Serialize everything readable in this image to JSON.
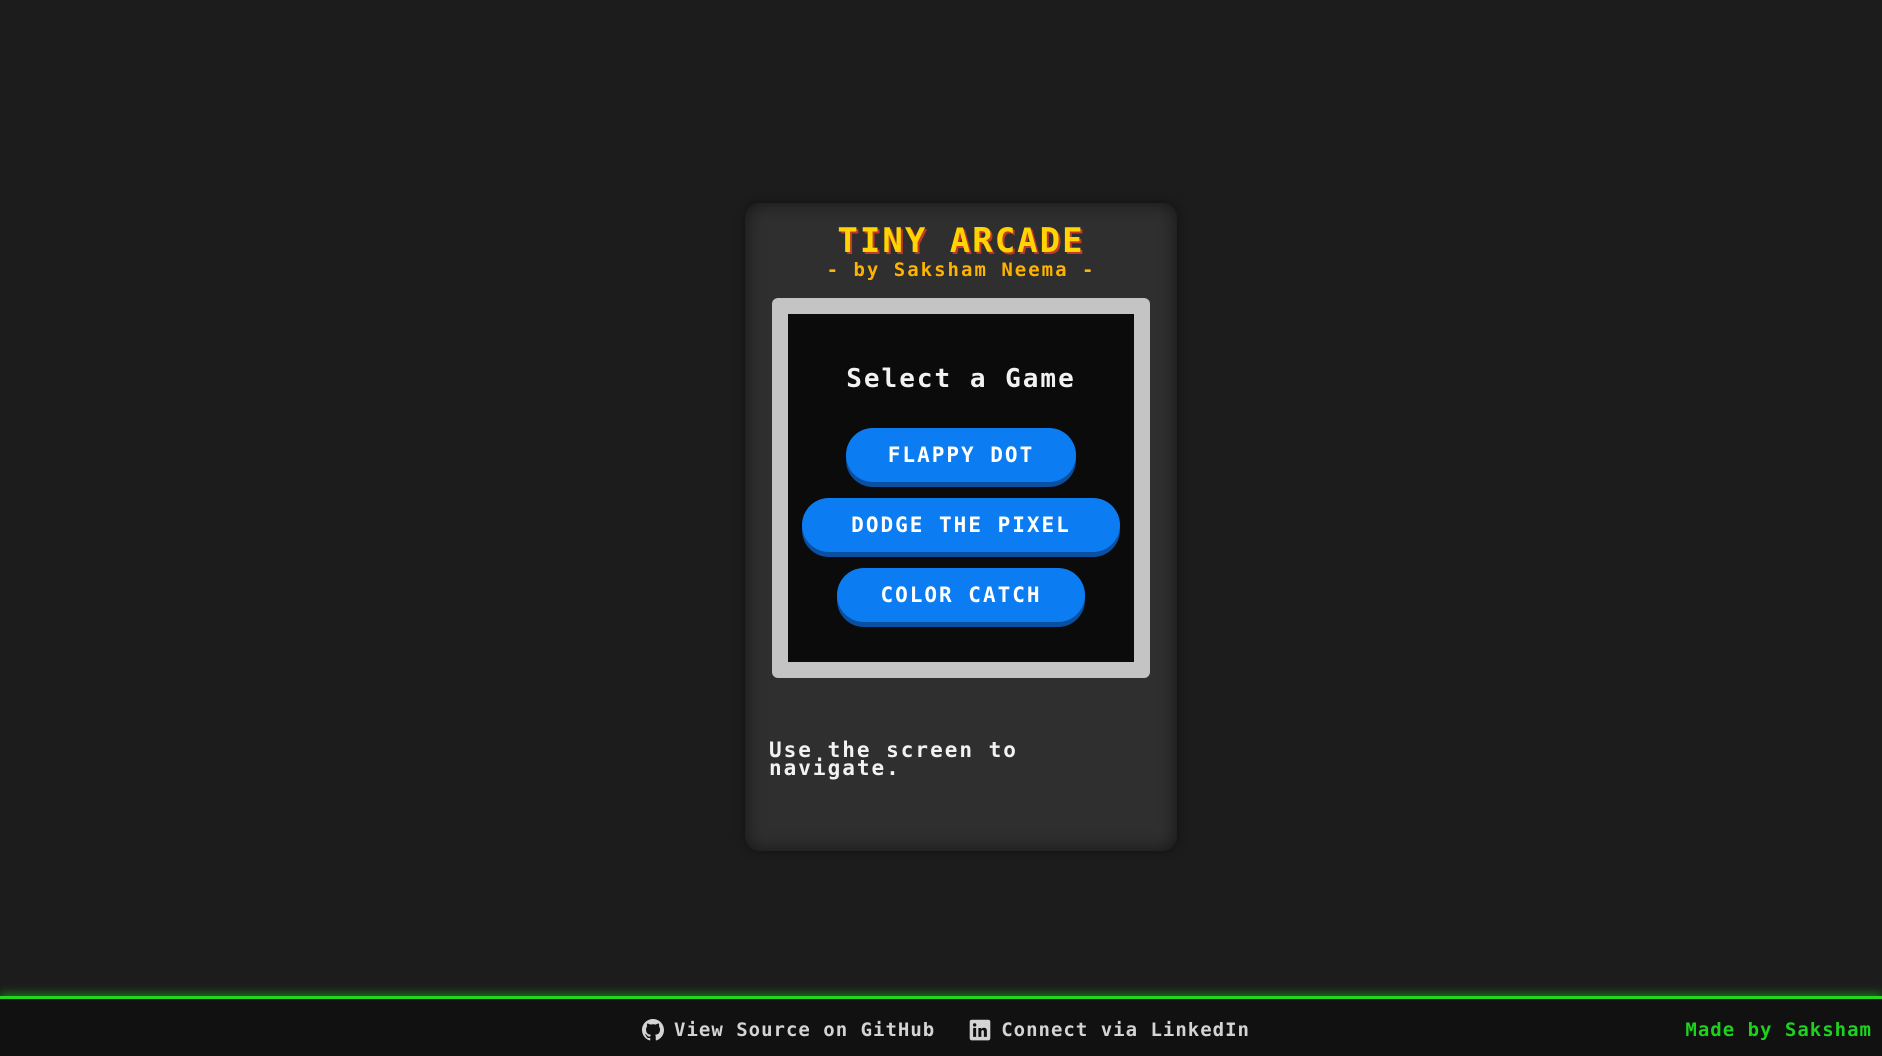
{
  "app": {
    "title": "TINY ARCADE",
    "subtitle": "- by Saksham Neema -"
  },
  "screen": {
    "heading": "Select a Game",
    "games": [
      {
        "label": "FLAPPY DOT"
      },
      {
        "label": "DODGE THE PIXEL"
      },
      {
        "label": "COLOR CATCH"
      }
    ]
  },
  "hint": "Use the screen to navigate.",
  "footer": {
    "github": {
      "label": "View Source on GitHub",
      "icon": "github-icon"
    },
    "linkedin": {
      "label": "Connect via LinkedIn",
      "icon": "linkedin-icon"
    },
    "credit": "Made by Saksham"
  },
  "colors": {
    "background": "#1c1c1c",
    "console": "#2f2f2f",
    "title": "#ffd400",
    "subtitle": "#ffb300",
    "button": "#0b7cf2",
    "footer_accent": "#22d622",
    "credit": "#1dd21d"
  }
}
